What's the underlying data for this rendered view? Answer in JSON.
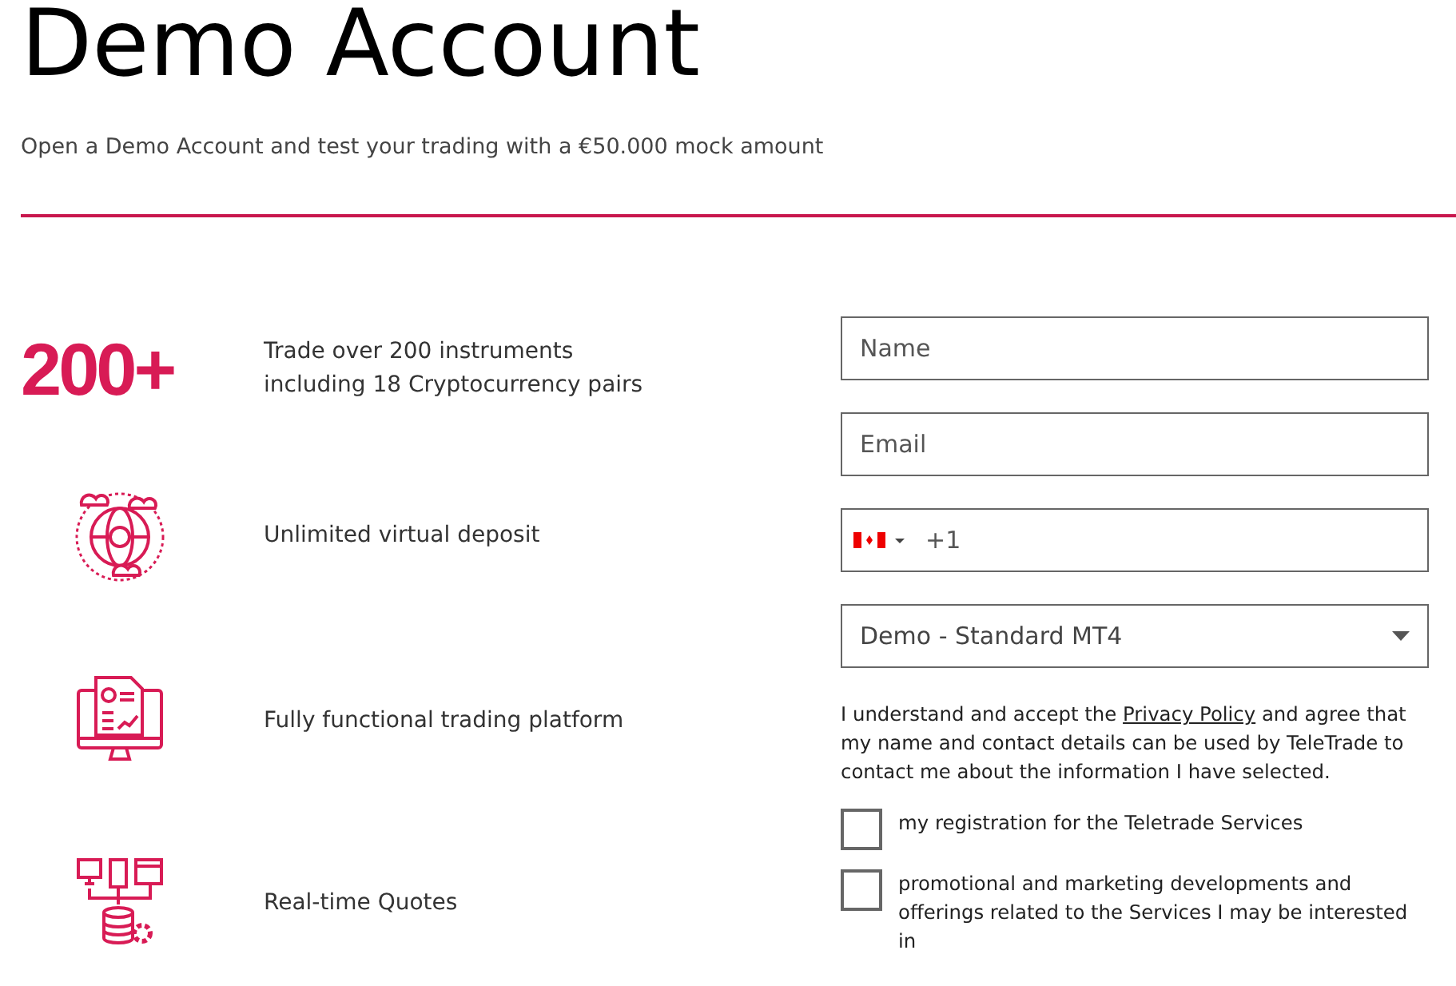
{
  "header": {
    "title": "Demo Account",
    "subtitle": "Open a Demo Account and test your trading with a €50.000 mock amount"
  },
  "features": [
    {
      "kind": "number",
      "figure": "200+",
      "text": "Trade over 200 instruments including 18 Cryptocurrency pairs"
    },
    {
      "kind": "globe",
      "text": "Unlimited virtual deposit"
    },
    {
      "kind": "monitor",
      "text": "Fully functional trading platform"
    },
    {
      "kind": "network",
      "text": "Real-time Quotes"
    }
  ],
  "form": {
    "name_field": {
      "placeholder": "Name"
    },
    "email_field": {
      "placeholder": "Email"
    },
    "phone_field": {
      "value": "+1"
    },
    "account_select": {
      "value": "Demo - Standard MT4"
    },
    "consent": {
      "before": "I understand and accept the ",
      "link": "Privacy Policy",
      "after": " and agree that my name and contact details can be used by TeleTrade to contact me about the information I have selected."
    },
    "checkboxes": [
      {
        "label": "my registration for the Teletrade Services",
        "checked": false
      },
      {
        "label": "promotional and marketing developments and offerings related to the Services I may be interested in",
        "checked": false
      }
    ]
  }
}
